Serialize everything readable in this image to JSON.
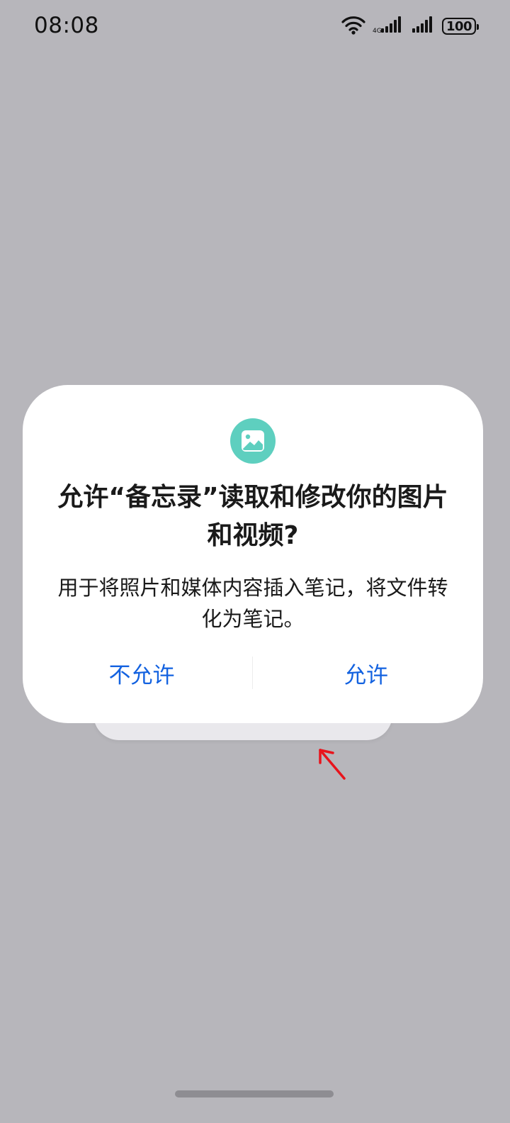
{
  "status_bar": {
    "time": "08:08",
    "battery": "100",
    "icons": [
      "wifi-icon",
      "cellular-signal-icon",
      "cellular-signal-icon",
      "battery-icon"
    ]
  },
  "dialog": {
    "icon": "photo-icon",
    "icon_color": "#5ecfbf",
    "title": "允许“备忘录”读取和修改你的图片和视频?",
    "message": "用于将照片和媒体内容插入笔记，将文件转化为笔记。",
    "deny_label": "不允许",
    "allow_label": "允许",
    "button_color": "#1362e0"
  },
  "annotation": {
    "icon": "arrow-up-left-icon",
    "color": "#e8141c"
  },
  "background_color": "#b7b6bb"
}
